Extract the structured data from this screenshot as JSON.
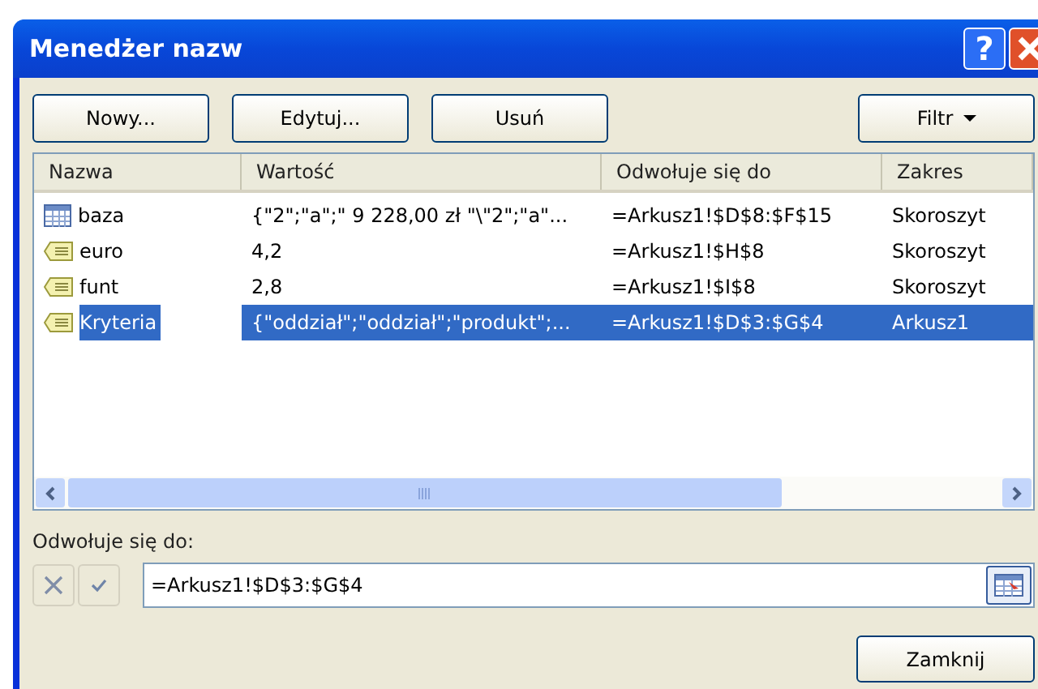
{
  "window": {
    "title": "Menedżer nazw"
  },
  "title_buttons": [
    "?"
  ],
  "buttons": [
    "Nowy...",
    "Edytuj...",
    "Usuń"
  ],
  "filter_button": {
    "label": "Filtr"
  },
  "table": {
    "columns": [
      "Nazwa",
      "Wartość",
      "Odwołuje się do",
      "Zakres"
    ],
    "rows": [
      {
        "kind": "table",
        "name": "baza",
        "value": "{\"2\";\"a\";\" 9 228,00 zł \"\\\"2\";\"a\"...",
        "refers_to": "=Arkusz1!$D$8:$F$15",
        "scope": "Skoroszyt",
        "selected": false
      },
      {
        "kind": "constant",
        "name": "euro",
        "value": "4,2",
        "refers_to": "=Arkusz1!$H$8",
        "scope": "Skoroszyt",
        "selected": false
      },
      {
        "kind": "constant",
        "name": "funt",
        "value": "2,8",
        "refers_to": "=Arkusz1!$I$8",
        "scope": "Skoroszyt",
        "selected": false
      },
      {
        "kind": "constant",
        "name": "Kryteria",
        "value": "{\"oddział\";\"oddział\";\"produkt\";...",
        "refers_to": "=Arkusz1!$D$3:$G$4",
        "scope": "Arkusz1",
        "selected": true
      }
    ]
  },
  "refers_to": {
    "label": "Odwołuje się do:",
    "value": "=Arkusz1!$D$3:$G$4"
  },
  "close_button": "Zamknij"
}
